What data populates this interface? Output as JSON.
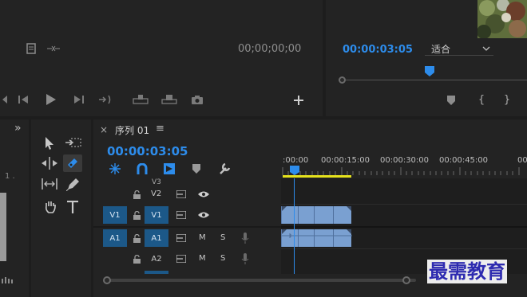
{
  "source_monitor": {
    "timecode": "00;00;00;00"
  },
  "program_monitor": {
    "timecode": "00:00:03:05",
    "fit_select": "适合"
  },
  "sequence": {
    "tab_label": "序列 01",
    "menu_icon": "≡",
    "close_icon": "×",
    "timecode": "00:00:03:05",
    "ruler": [
      ":00:00",
      "00:00:15:00",
      "00:00:30:00",
      "00:00:45:00",
      "00"
    ]
  },
  "tracks": {
    "v3": "V3",
    "v2": "V2",
    "v1_src": "V1",
    "v1": "V1",
    "a1_src": "A1",
    "a1": "A1",
    "a2": "A2",
    "m": "M",
    "s": "S",
    "m2": "M",
    "s2": "S"
  },
  "left_panel": {
    "expand": "»",
    "num": "1 ."
  },
  "watermark": "最需教育",
  "accent": "#2d8ceb",
  "icons": [
    "frame-icon",
    "marker-icon",
    "step-back-icon",
    "play-icon",
    "step-forward-icon",
    "insert-icon",
    "lift-icon",
    "extract-icon",
    "camera-icon",
    "plus-icon",
    "selection-tool-icon",
    "track-select-icon",
    "ripple-edit-icon",
    "razor-tool-icon",
    "slip-tool-icon",
    "pen-tool-icon",
    "hand-tool-icon",
    "type-tool-icon",
    "snap-icon",
    "linked-icon",
    "add-marker-icon",
    "wrench-icon",
    "lock-icon",
    "eye-icon",
    "mic-icon"
  ]
}
